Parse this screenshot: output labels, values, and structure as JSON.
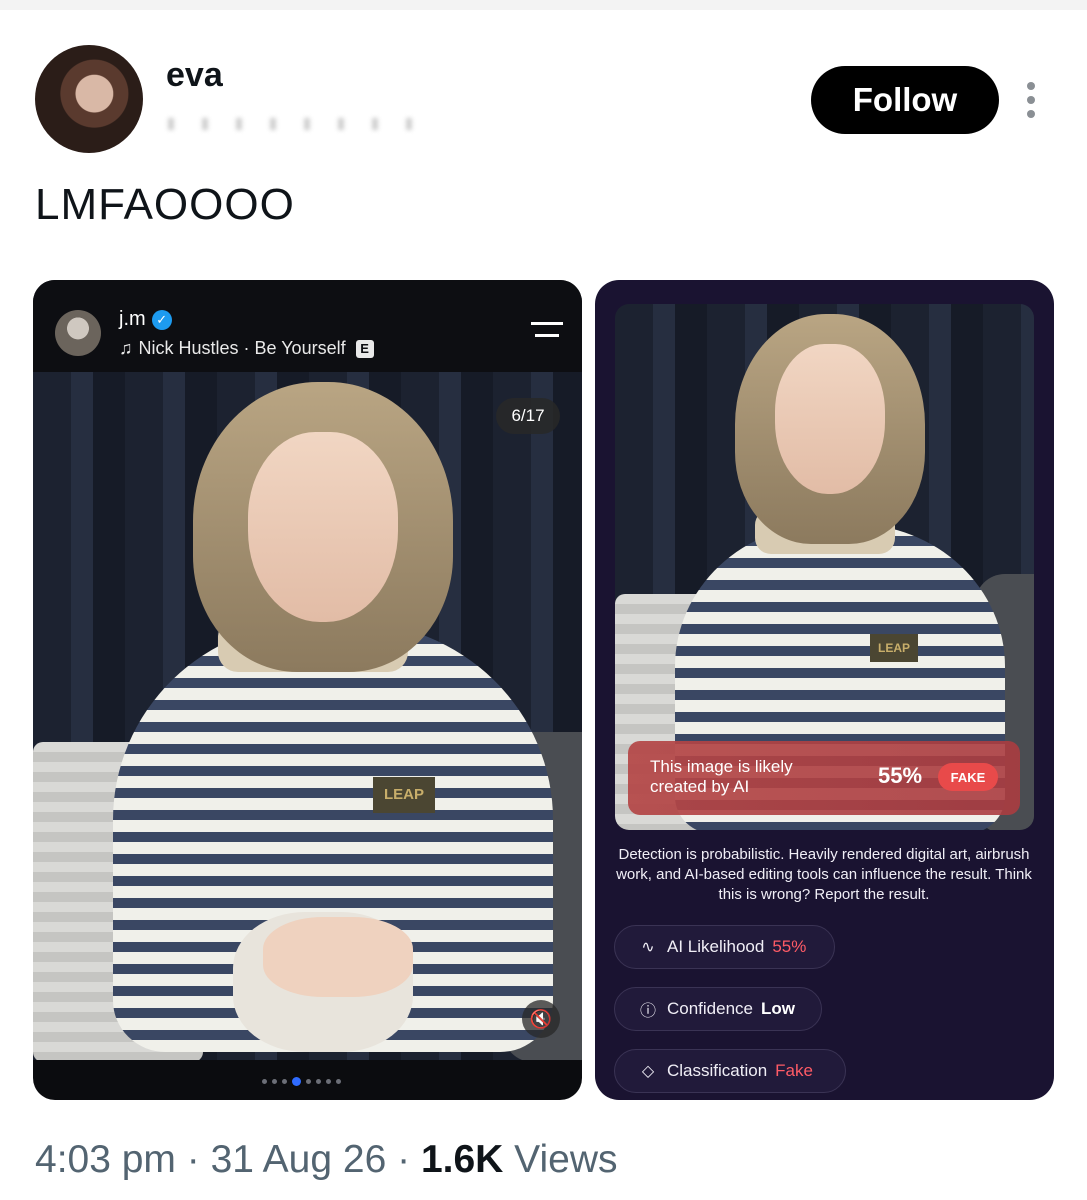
{
  "post": {
    "author_name": "eva",
    "follow_label": "Follow",
    "text": "LMFAOOOO",
    "time": "4:03 pm",
    "date": "31 Aug 26",
    "views_count": "1.6K",
    "views_label": "Views"
  },
  "left_card": {
    "username": "j.m",
    "music": "Nick Hustles · Be Yourself",
    "explicit": "E",
    "page_counter": "6/17",
    "carousel_active_index": 3,
    "carousel_count": 8
  },
  "right_card": {
    "banner_text": "This image is likely created by AI",
    "banner_percent": "55%",
    "banner_badge": "FAKE",
    "disclaimer": "Detection is probabilistic. Heavily rendered digital art, airbrush work, and AI-based editing tools can influence the result. Think this is wrong? Report the result.",
    "pills": [
      {
        "label": "AI Likelihood",
        "value": "55%"
      },
      {
        "label": "Confidence",
        "value": "Low"
      },
      {
        "label": "Classification",
        "value": "Fake"
      }
    ]
  },
  "icons": [
    "more-icon",
    "verified-icon",
    "music-note-icon",
    "menu-icon",
    "mute-icon",
    "pulse-icon",
    "info-icon",
    "tag-icon"
  ],
  "colors": {
    "follow_bg": "#000000",
    "accent_blue": "#1d9bf0",
    "fake_red": "#e84a4a",
    "card_purple": "#1a1331"
  }
}
